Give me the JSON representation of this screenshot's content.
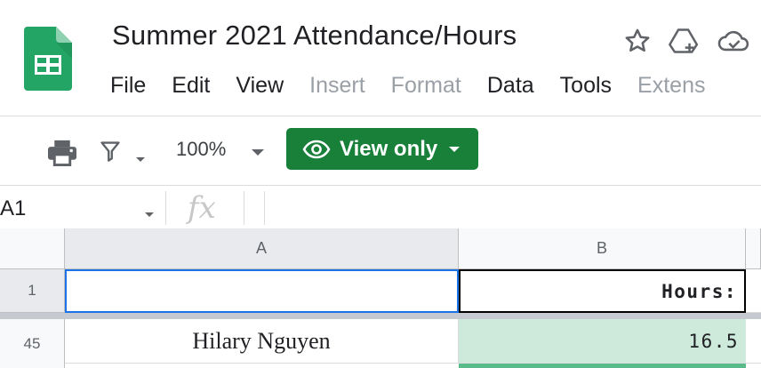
{
  "document": {
    "title": "Summer 2021 Attendance/Hours"
  },
  "menu": [
    {
      "label": "File",
      "enabled": true
    },
    {
      "label": "Edit",
      "enabled": true
    },
    {
      "label": "View",
      "enabled": true
    },
    {
      "label": "Insert",
      "enabled": false
    },
    {
      "label": "Format",
      "enabled": false
    },
    {
      "label": "Data",
      "enabled": true
    },
    {
      "label": "Tools",
      "enabled": true
    },
    {
      "label": "Extens",
      "enabled": false
    }
  ],
  "title_icons": [
    "star-icon",
    "move-to-drive-icon",
    "cloud-status-icon"
  ],
  "toolbar": {
    "print_icon": "print-icon",
    "filter_icon": "filter-icon",
    "zoom": "100%",
    "view_only_label": "View only"
  },
  "formula_bar": {
    "cell_ref": "A1",
    "fx_label": "fx",
    "formula": ""
  },
  "grid": {
    "columns": [
      "A",
      "B"
    ],
    "rows": [
      {
        "row": "1",
        "a": "",
        "b": "Hours:"
      },
      {
        "row": "45",
        "a": "Hilary Nguyen",
        "b": "16.5"
      }
    ]
  },
  "colors": {
    "brand_green": "#188038",
    "selection_blue": "#1a73e8",
    "cell_highlight": "#cdeadb",
    "cell_highlight_strong": "#57bb8a",
    "disabled_text": "#9aa0a6"
  }
}
